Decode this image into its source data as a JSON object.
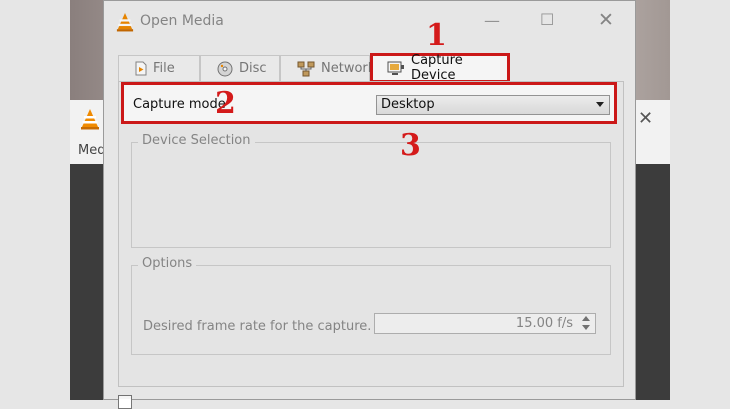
{
  "background_window": {
    "menu_partial": "Med"
  },
  "dialog": {
    "title": "Open Media",
    "tabs": [
      {
        "label": "File"
      },
      {
        "label": "Disc"
      },
      {
        "label": "Network"
      },
      {
        "label": "Capture Device"
      }
    ],
    "active_tab": "Capture Device",
    "capture_mode": {
      "label": "Capture mode",
      "selected": "Desktop"
    },
    "device_selection": {
      "legend": "Device Selection"
    },
    "options": {
      "legend": "Options",
      "frame_rate_label": "Desired frame rate for the capture.",
      "frame_rate_value": "15.00 f/s"
    }
  },
  "annotations": [
    "1",
    "2",
    "3"
  ],
  "colors": {
    "annotation_red": "#d41a1a",
    "dialog_bg": "#f0f0f0"
  }
}
